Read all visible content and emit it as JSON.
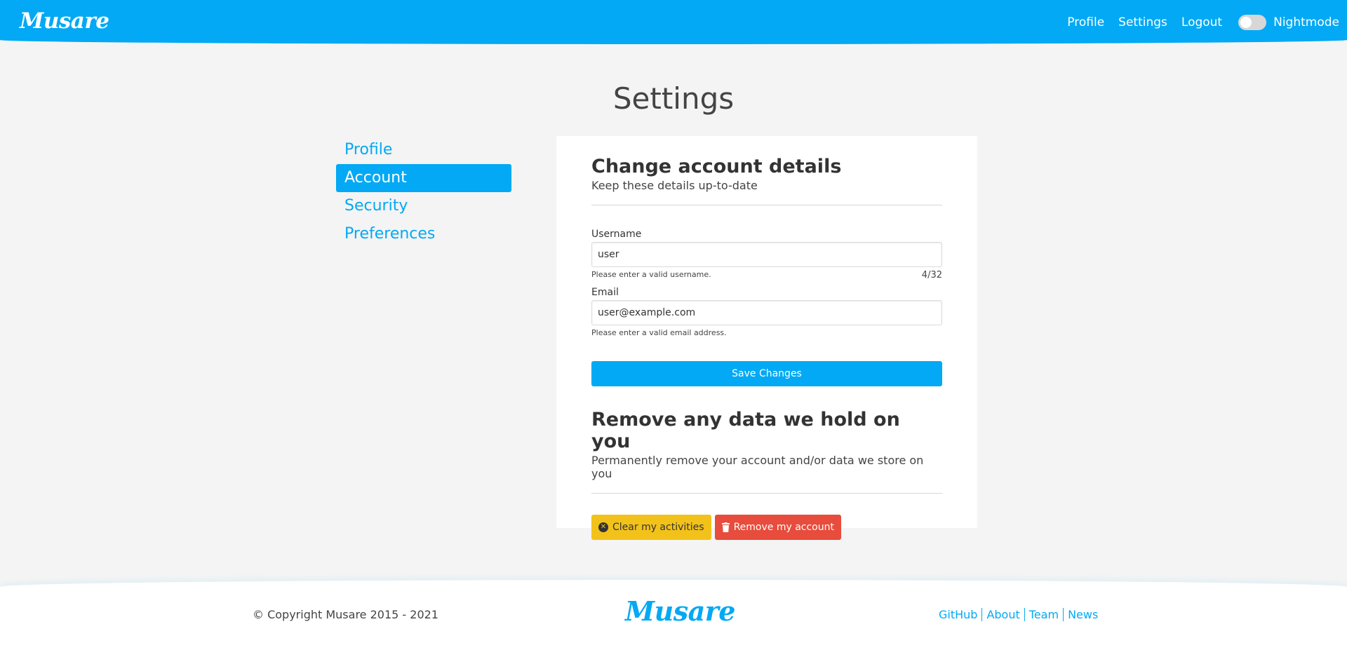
{
  "header": {
    "logo": "Musare",
    "nav": [
      "Profile",
      "Settings",
      "Logout"
    ],
    "nightmode_label": "Nightmode",
    "nightmode_on": false
  },
  "page_title": "Settings",
  "sidebar": {
    "items": [
      {
        "label": "Profile",
        "active": false
      },
      {
        "label": "Account",
        "active": true
      },
      {
        "label": "Security",
        "active": false
      },
      {
        "label": "Preferences",
        "active": false
      }
    ]
  },
  "account": {
    "title": "Change account details",
    "subtitle": "Keep these details up-to-date",
    "username": {
      "label": "Username",
      "value": "user",
      "help": "Please enter a valid username.",
      "counter": "4/32"
    },
    "email": {
      "label": "Email",
      "value": "user@example.com",
      "help": "Please enter a valid email address."
    },
    "save_label": "Save Changes"
  },
  "remove": {
    "title": "Remove any data we hold on you",
    "subtitle": "Permanently remove your account and/or data we store on you",
    "clear_label": "Clear my activities",
    "remove_label": "Remove my account"
  },
  "footer": {
    "copyright": "© Copyright Musare 2015 - 2021",
    "logo": "Musare",
    "links": [
      "GitHub",
      "About",
      "Team",
      "News"
    ]
  },
  "colors": {
    "primary": "#03a9f4",
    "warning": "#f2c21a",
    "danger": "#e74c3c",
    "background": "#f4f4f4"
  }
}
